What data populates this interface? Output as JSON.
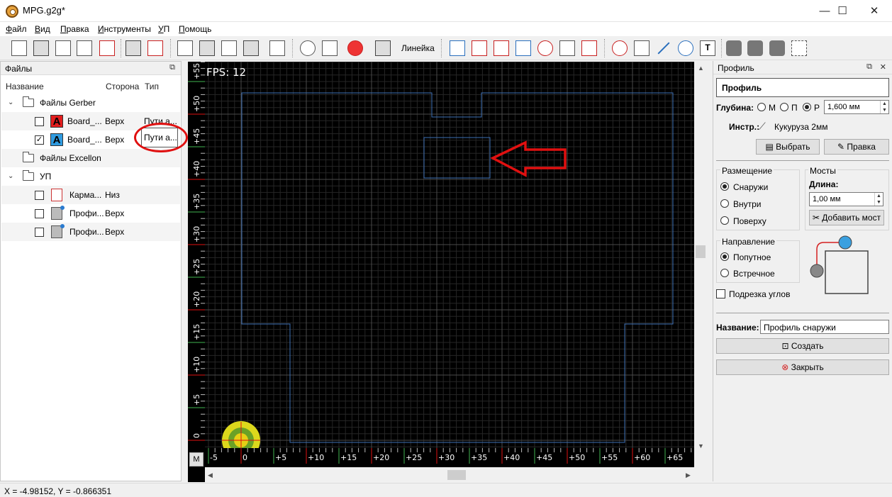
{
  "window": {
    "title": "MPG.g2g*",
    "controls": [
      "—",
      "☐",
      "✕"
    ]
  },
  "menu": [
    "Файл",
    "Вид",
    "Правка",
    "Инструменты",
    "УП",
    "Помощь"
  ],
  "toolbar": {
    "ruler_label": "Линейка"
  },
  "files_panel": {
    "title": "Файлы",
    "columns": [
      "Название",
      "Сторона",
      "Тип"
    ],
    "groups": {
      "gerber": "Файлы Gerber",
      "excellon": "Файлы Excellon",
      "cam": "УП"
    },
    "rows": [
      {
        "name": "Board_...",
        "side": "Верх",
        "type": "Пути а...",
        "checked": false,
        "badge": "A",
        "badge_color": "#e11d1d"
      },
      {
        "name": "Board_...",
        "side": "Верх",
        "type": "Пути а...",
        "checked": true,
        "badge": "A",
        "badge_color": "#2f9be0"
      },
      {
        "name": "Карма...",
        "side": "Низ",
        "checked": false
      },
      {
        "name": "Профи...",
        "side": "Верх",
        "checked": false
      },
      {
        "name": "Профи...",
        "side": "Верх",
        "checked": false
      }
    ],
    "check_mark": "✓"
  },
  "viewport": {
    "fps": "FPS: 12",
    "mode_button": "M",
    "x_ticks": [
      "-5",
      "0",
      "+5",
      "+10",
      "+15",
      "+20",
      "+25",
      "+30",
      "+35",
      "+40",
      "+45",
      "+50",
      "+55",
      "+60",
      "+65"
    ],
    "y_ticks": [
      "0",
      "+5",
      "+10",
      "+15",
      "+20",
      "+25",
      "+30",
      "+35",
      "+40",
      "+45",
      "+50",
      "+55"
    ],
    "colors": {
      "background": "#000000",
      "grid": "#2a2a2a",
      "contour": "#3d6fb5",
      "arrow": "#e01010"
    }
  },
  "profile_panel": {
    "title": "Профиль",
    "heading": "Профиль",
    "depth_label": "Глубина:",
    "depth_options": [
      "М",
      "П",
      "Р"
    ],
    "depth_selected": "Р",
    "depth_value": "1,600 мм",
    "tool_label": "Инстр.:",
    "tool_name": "Кукуруза 2мм",
    "select_button": "Выбрать",
    "edit_button": "Правка",
    "placement_title": "Размещение",
    "placement_options": [
      "Снаружи",
      "Внутри",
      "Поверху"
    ],
    "placement_selected": "Снаружи",
    "bridges_title": "Мосты",
    "length_label": "Длина:",
    "length_value": "1,00 мм",
    "add_bridge_button": "Добавить мост",
    "direction_title": "Направление",
    "direction_options": [
      "Попутное",
      "Встречное"
    ],
    "direction_selected": "Попутное",
    "corner_trim_label": "Подрезка углов",
    "name_label": "Название:",
    "name_value": "Профиль снаружи",
    "create_button": "Создать",
    "close_button": "Закрыть"
  },
  "status": {
    "coords": "X = -4.98152, Y = -0.866351"
  }
}
